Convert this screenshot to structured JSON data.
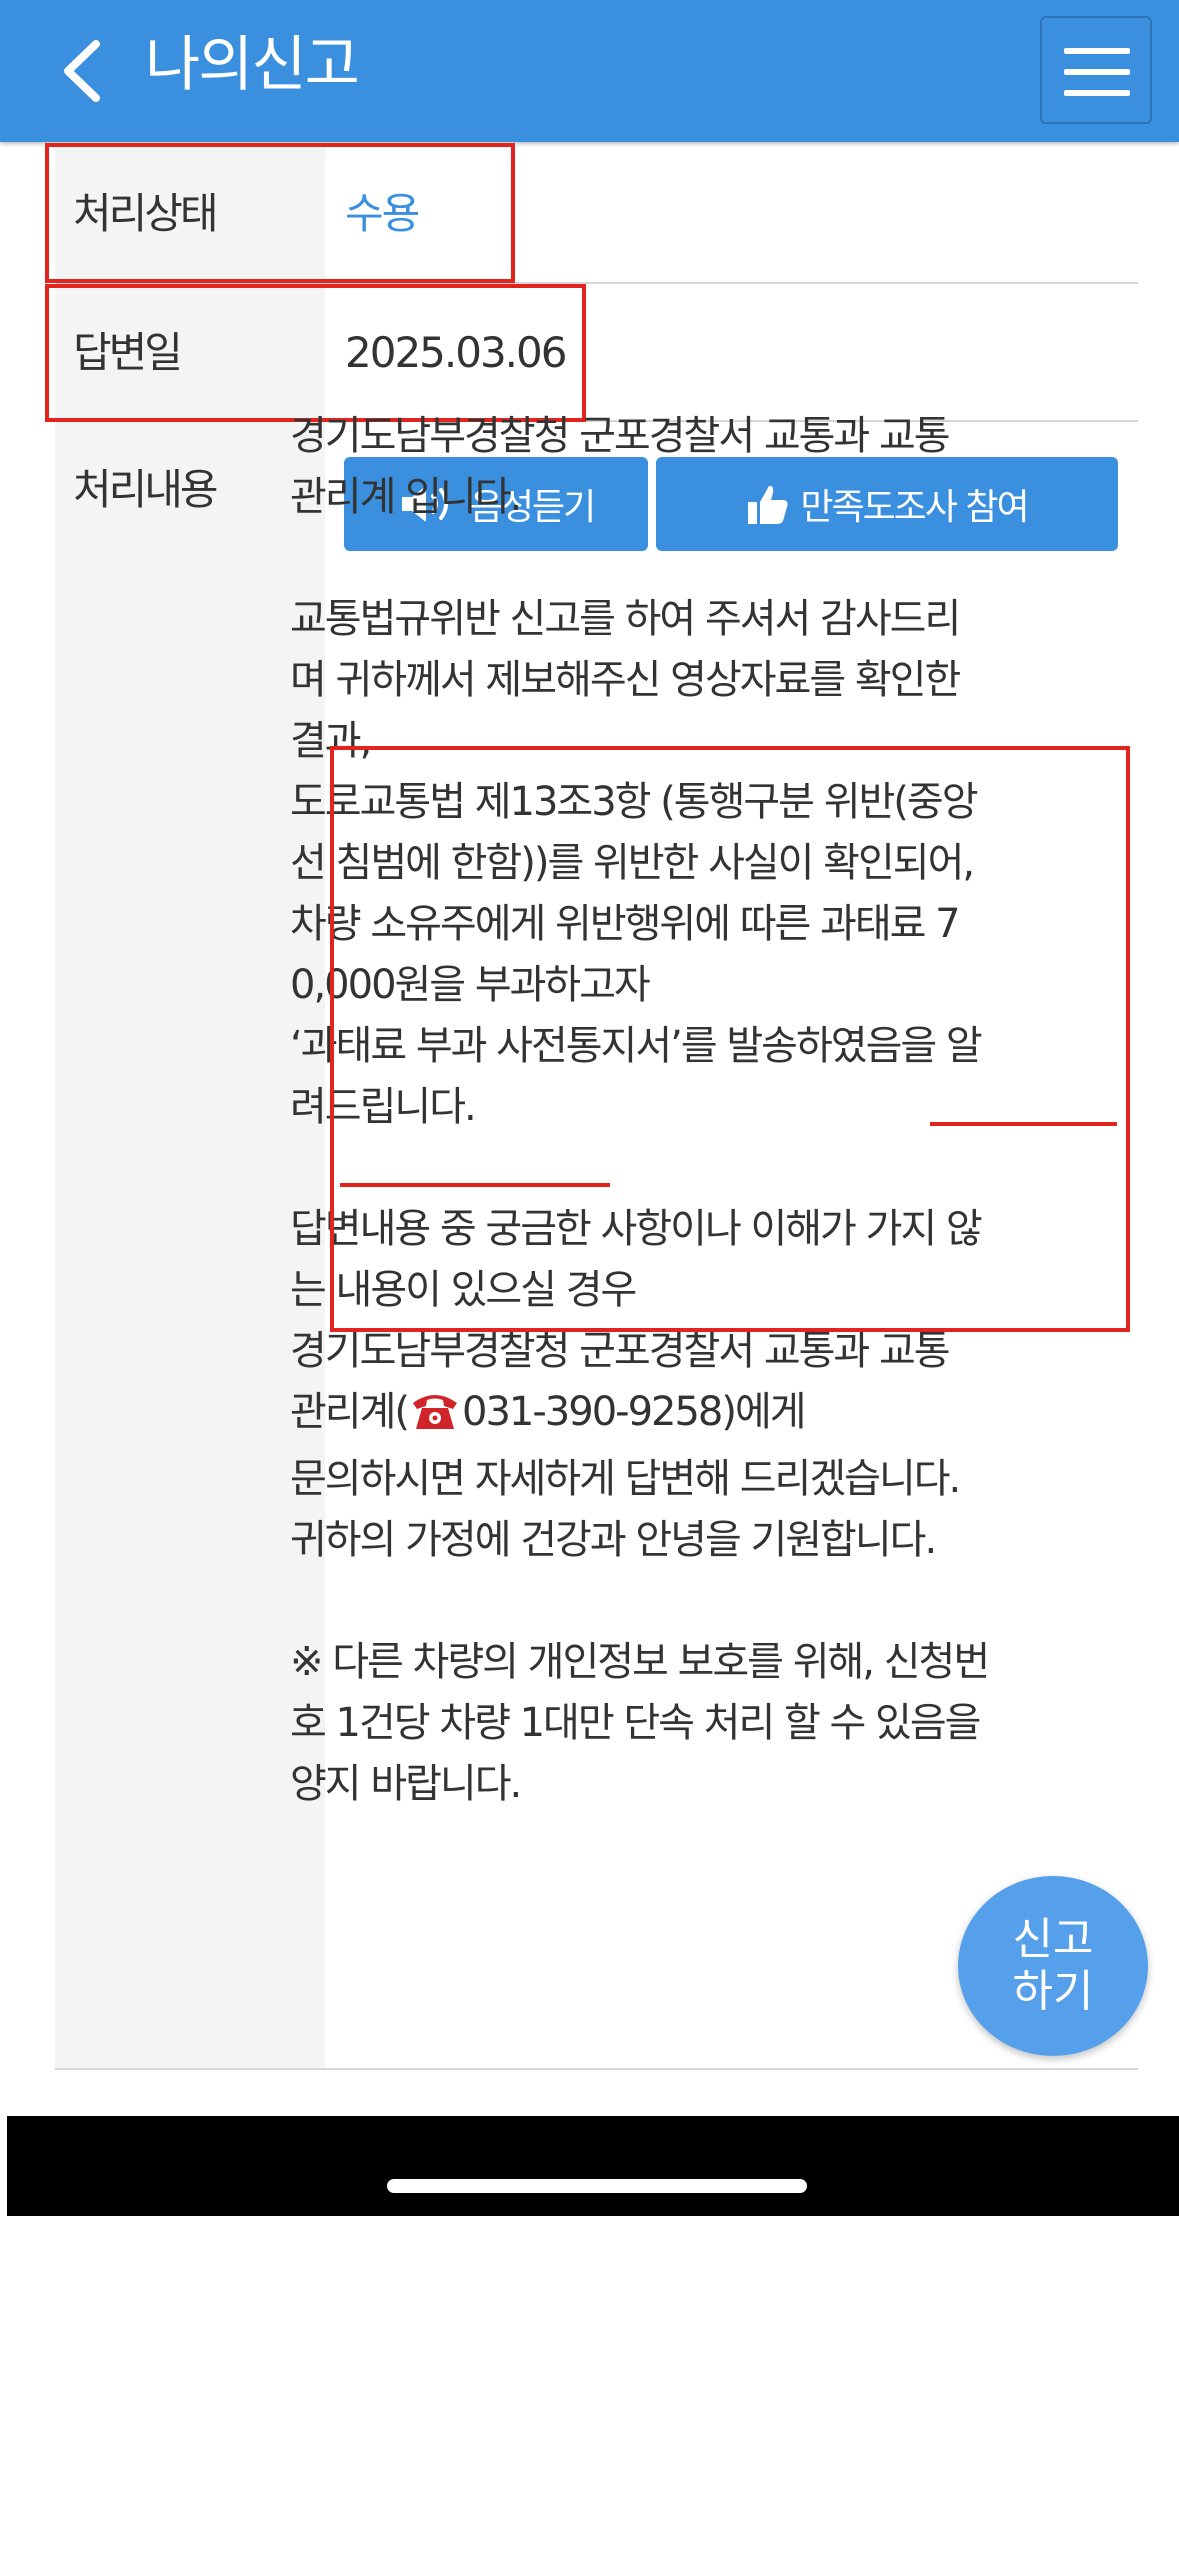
{
  "header": {
    "title": "나의신고",
    "back_icon": "chevron-left-icon",
    "menu_icon": "hamburger-menu-icon"
  },
  "status_row": {
    "label": "처리상태",
    "value": "수용",
    "value_color": "#3a8fdf"
  },
  "date_row": {
    "label": "답변일",
    "value": "2025.03.06"
  },
  "content_row": {
    "label": "처리내용",
    "listen_button": "음성듣기",
    "survey_button": "만족도조사 참여",
    "intro": [
      "경기도남부경찰청 군포경찰서 교통과 교통",
      "관리계 입니다."
    ],
    "main": [
      "교통법규위반 신고를 하여 주셔서 감사드리",
      "며 귀하께서 제보해주신 영상자료를 확인한",
      "결과,",
      "도로교통법 제13조3항 (통행구분 위반(중앙",
      "선 침범에 한함))를 위반한 사실이 확인되어,",
      "차량 소유주에게 위반행위에 따른 과태료 7",
      "0,000원을 부과하고자",
      "‘과태료 부과 사전통지서’를 발송하였음을 알",
      "려드립니다."
    ],
    "inquiry": [
      "답변내용 중 궁금한 사항이나 이해가 가지 않",
      "는 내용이 있으실 경우",
      "경기도남부경찰청 군포경찰서 교통과 교통"
    ],
    "phone_prefix": "관리계(",
    "phone_icon": "telephone-icon",
    "phone_number": "031-390-9258",
    "phone_suffix": ")에게",
    "closing": [
      "문의하시면 자세하게 답변해 드리겠습니다.",
      "귀하의 가정에 건강과 안녕을 기원합니다."
    ],
    "notice": [
      "※ 다른 차량의 개인정보 보호를 위해, 신청번",
      "호 1건당 차량 1대만 단속 처리 할 수 있음을",
      "양지 바랍니다."
    ]
  },
  "fab": {
    "line1": "신고",
    "line2": "하기"
  },
  "colors": {
    "header": "#3a8fdf",
    "highlight": "#e2241f"
  }
}
